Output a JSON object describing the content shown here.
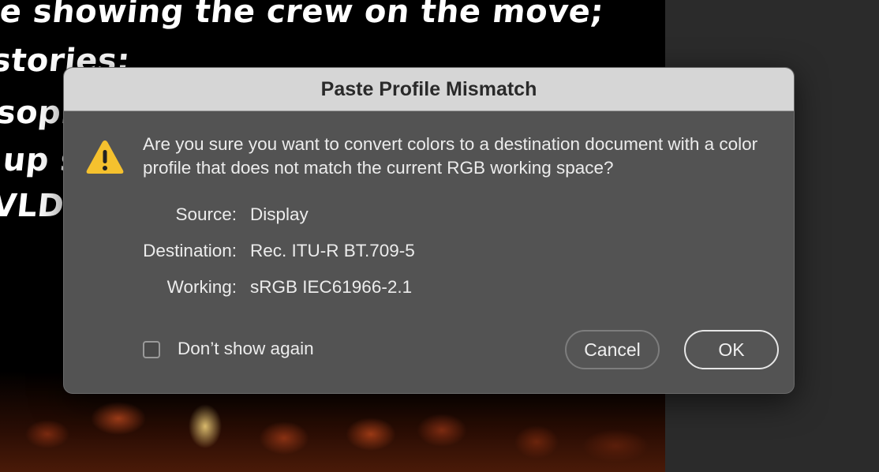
{
  "background_document": {
    "text_lines": [
      "e showing the crew on the move;",
      "stories;",
      "sophi",
      "up s",
      "VLD B"
    ]
  },
  "dialog": {
    "title": "Paste Profile Mismatch",
    "icon": "warning-triangle-icon",
    "message": "Are you sure you want to convert colors to a destination document with a color profile that does not match the current RGB working space?",
    "details": [
      {
        "label": "Source:",
        "value": "Display"
      },
      {
        "label": "Destination:",
        "value": "Rec. ITU-R BT.709-5"
      },
      {
        "label": "Working:",
        "value": "sRGB IEC61966-2.1"
      }
    ],
    "checkbox": {
      "label": "Don’t show again",
      "checked": false
    },
    "buttons": {
      "cancel": "Cancel",
      "ok": "OK"
    }
  },
  "colors": {
    "dialog_bg": "#535353",
    "titlebar_bg": "#d6d6d6",
    "warning_yellow": "#f5c12e",
    "pasteboard": "#2b2b2b"
  }
}
